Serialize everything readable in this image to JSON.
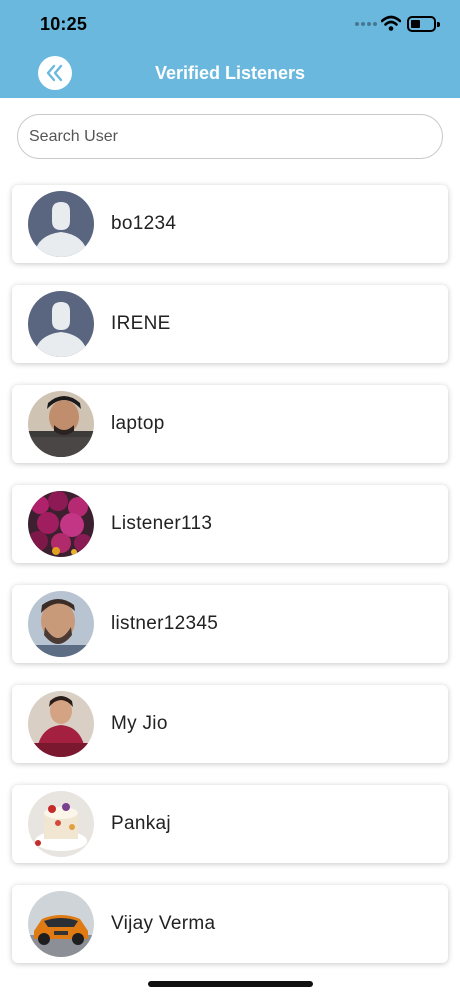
{
  "status_bar": {
    "time": "10:25",
    "battery_level": 0.3
  },
  "header": {
    "title": "Verified Listeners",
    "back_icon": "double-chevron-left-icon"
  },
  "search": {
    "placeholder": "Search User",
    "value": ""
  },
  "colors": {
    "header_bg": "#6bb8de",
    "card_bg": "#ffffff",
    "text": "#222222"
  },
  "users": [
    {
      "name": "bo1234",
      "avatar": "default-person-avatar"
    },
    {
      "name": "IRENE",
      "avatar": "default-person-avatar"
    },
    {
      "name": "laptop",
      "avatar": "user-photo"
    },
    {
      "name": "Listener113",
      "avatar": "flowers-photo"
    },
    {
      "name": "listner12345",
      "avatar": "user-photo"
    },
    {
      "name": "My Jio",
      "avatar": "user-photo"
    },
    {
      "name": "Pankaj",
      "avatar": "cake-photo"
    },
    {
      "name": "Vijay Verma",
      "avatar": "orange-car-photo"
    }
  ]
}
